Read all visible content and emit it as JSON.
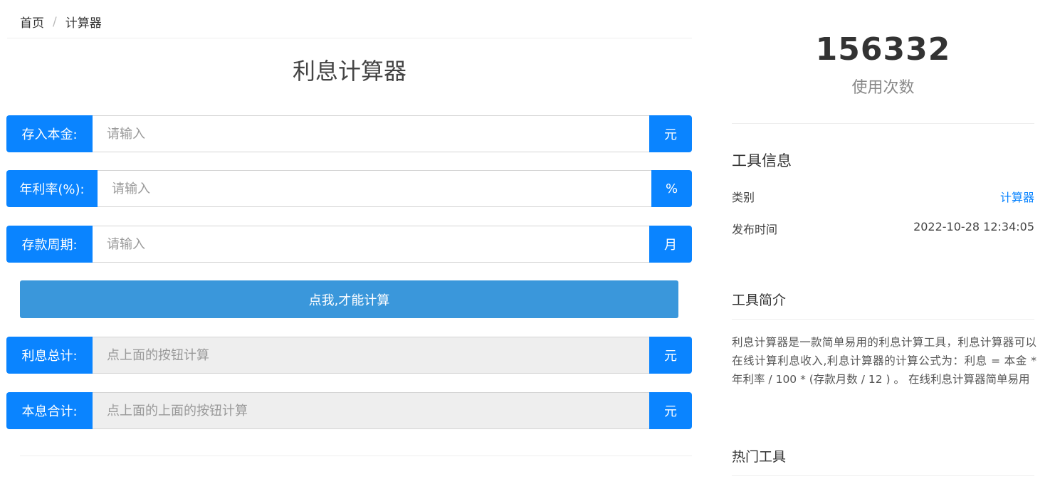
{
  "breadcrumb": {
    "home": "首页",
    "separator": "/",
    "current": "计算器"
  },
  "title": "利息计算器",
  "form": {
    "principal": {
      "label": "存入本金:",
      "placeholder": "请输入",
      "unit": "元"
    },
    "rate": {
      "label": "年利率(%):",
      "placeholder": "请输入",
      "unit": "%"
    },
    "period": {
      "label": "存款周期:",
      "placeholder": "请输入",
      "unit": "月"
    },
    "calculate_button": "点我,才能计算",
    "interest_total": {
      "label": "利息总计:",
      "placeholder": "点上面的按钮计算",
      "unit": "元"
    },
    "sum_total": {
      "label": "本息合计:",
      "placeholder": "点上面的上面的按钮计算",
      "unit": "元"
    }
  },
  "stats": {
    "count": "156332",
    "count_label": "使用次数"
  },
  "tool_info": {
    "title": "工具信息",
    "category_label": "类别",
    "category_value": "计算器",
    "published_label": "发布时间",
    "published_value": "2022-10-28 12:34:05"
  },
  "intro": {
    "title": "工具简介",
    "text": "利息计算器是一款简单易用的利息计算工具，利息计算器可以在线计算利息收入,利息计算器的计算公式为：利息 = 本金 * 年利率 / 100 * (存款月数 / 12 ) 。 在线利息计算器简单易用"
  },
  "hot_tools": {
    "title": "热门工具"
  },
  "colors": {
    "accent": "#0a84ff",
    "button": "#3a97db"
  }
}
